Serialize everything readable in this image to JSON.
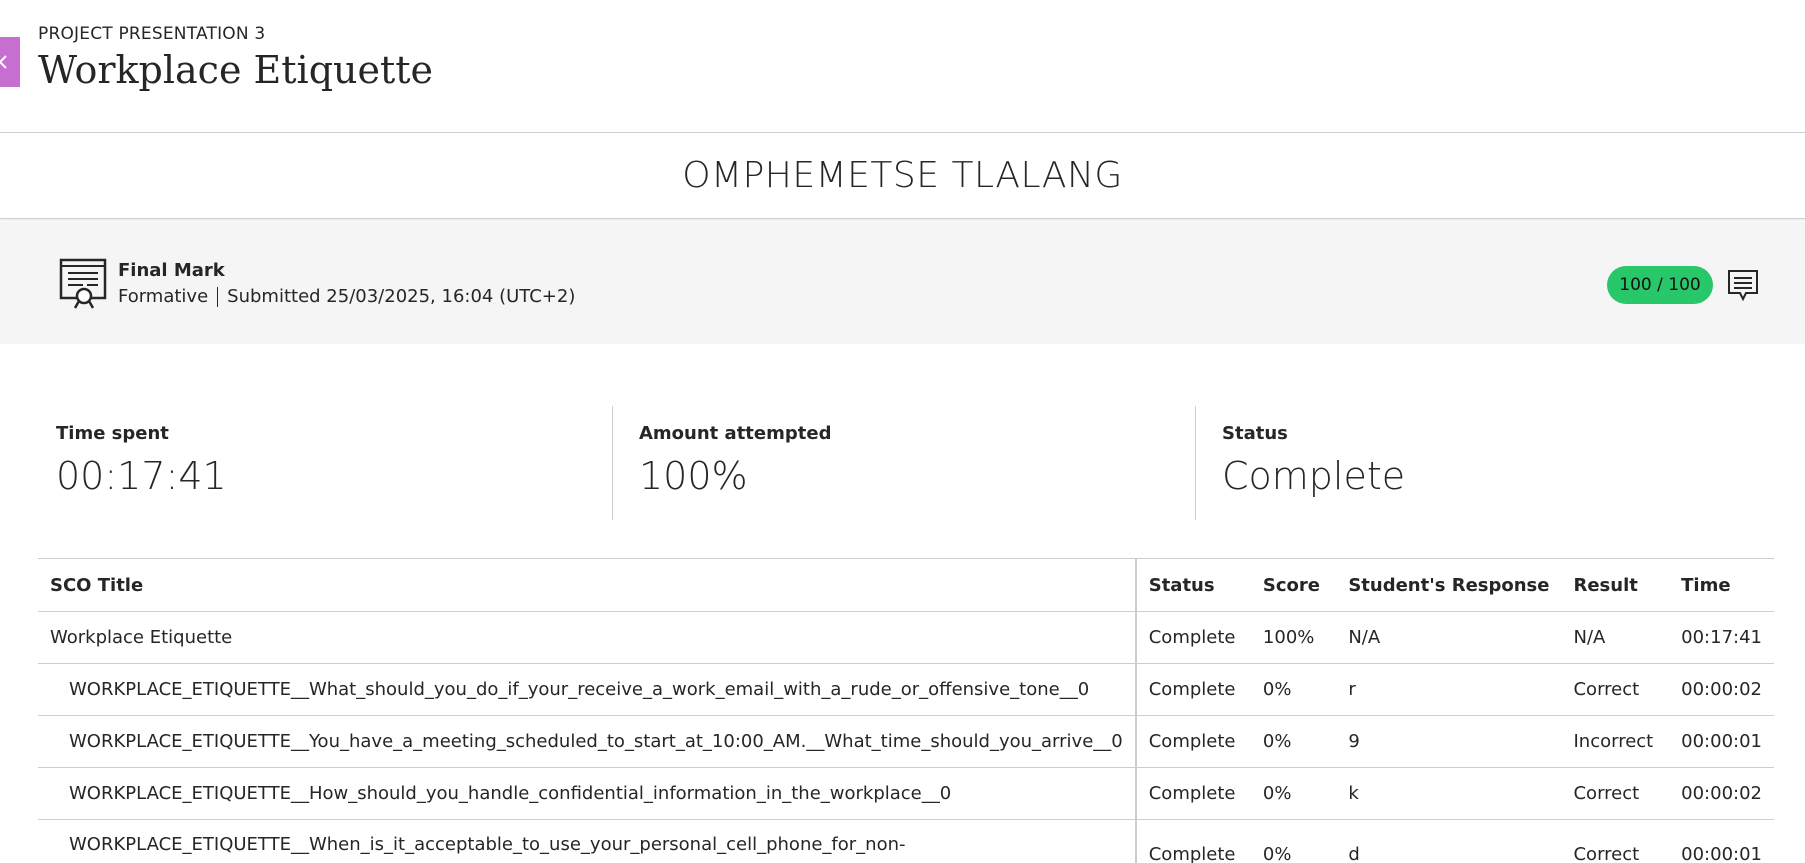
{
  "header": {
    "eyebrow": "PROJECT PRESENTATION 3",
    "title": "Workplace Etiquette"
  },
  "student": {
    "name": "OMPHEMETSE TLALANG"
  },
  "grade": {
    "title": "Final Mark",
    "type": "Formative",
    "submitted": "Submitted 25/03/2025, 16:04 (UTC+2)",
    "score": "100 / 100",
    "score_color": "#28c76a"
  },
  "stats": [
    {
      "label": "Time spent",
      "value": "00:17:41"
    },
    {
      "label": "Amount attempted",
      "value": "100%"
    },
    {
      "label": "Status",
      "value": "Complete"
    }
  ],
  "table": {
    "headers": [
      "SCO Title",
      "Status",
      "Score",
      "Student's Response",
      "Result",
      "Time"
    ],
    "rows": [
      {
        "title": "Workplace Etiquette",
        "status": "Complete",
        "score": "100%",
        "response": "N/A",
        "result": "N/A",
        "time": "00:17:41"
      },
      {
        "title": "WORKPLACE_ETIQUETTE__What_should_you_do_if_your_receive_a_work_email_with_a_rude_or_offensive_tone__0",
        "status": "Complete",
        "score": "0%",
        "response": "r",
        "result": "Correct",
        "time": "00:00:02"
      },
      {
        "title": "WORKPLACE_ETIQUETTE__You_have_a_meeting_scheduled_to_start_at_10:00_AM.__What_time_should_you_arrive__0",
        "status": "Complete",
        "score": "0%",
        "response": "9",
        "result": "Incorrect",
        "time": "00:00:01"
      },
      {
        "title": "WORKPLACE_ETIQUETTE__How_should_you_handle_confidential_information_in_the_workplace__0",
        "status": "Complete",
        "score": "0%",
        "response": "k",
        "result": "Correct",
        "time": "00:00:02"
      },
      {
        "title": "WORKPLACE_ETIQUETTE__When_is_it_acceptable_to_use_your_personal_cell_phone_for_non-",
        "status": "Complete",
        "score": "0%",
        "response": "d",
        "result": "Correct",
        "time": "00:00:01"
      }
    ]
  },
  "icons": {
    "back": "chevron-left-icon",
    "grade": "certificate-icon",
    "feedback": "comment-icon"
  }
}
